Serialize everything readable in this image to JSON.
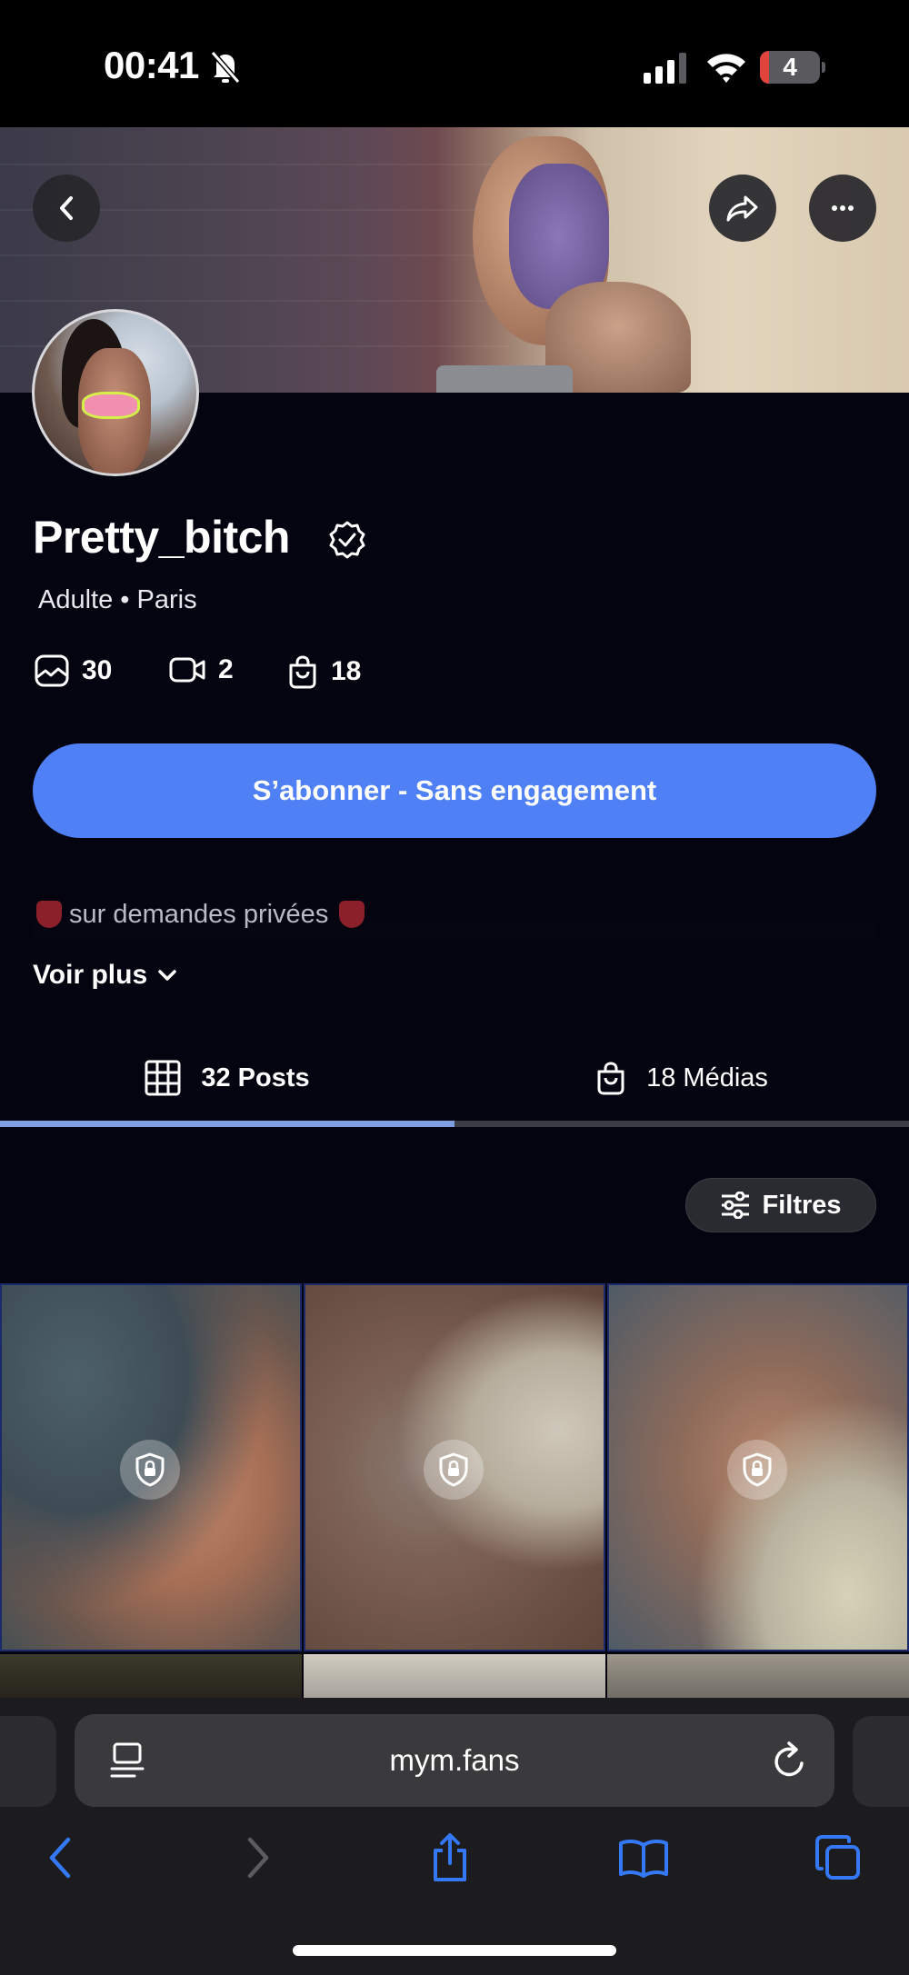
{
  "status_bar": {
    "time": "00:41",
    "battery_level": "4",
    "icons": [
      "bell-slash-icon",
      "cellular-signal-icon",
      "wifi-icon",
      "battery-icon"
    ]
  },
  "header": {
    "icons": [
      "chevron-left-icon",
      "share-arrow-icon",
      "more-dots-icon"
    ]
  },
  "profile": {
    "name": "Pretty_bitch",
    "subtitle": "Adulte • Paris",
    "stats": {
      "photos": "30",
      "videos": "2",
      "shop": "18"
    },
    "subscribe_label": "S’abonner - Sans engagement",
    "bio": "sur demandes privées",
    "see_more": "Voir plus"
  },
  "tabs": {
    "posts": "32 Posts",
    "medias": "18 Médias",
    "active": "posts"
  },
  "filters_label": "Filtres",
  "browser": {
    "url": "mym.fans",
    "toolbar_icons": [
      "back-arrow-icon",
      "forward-arrow-icon",
      "share-icon",
      "bookmarks-icon",
      "tabs-icon"
    ]
  },
  "colors": {
    "background": "#03040f",
    "accent": "#4f80f5",
    "tab_indicator": "#7f9ee0",
    "safari_tint": "#3478f6"
  }
}
